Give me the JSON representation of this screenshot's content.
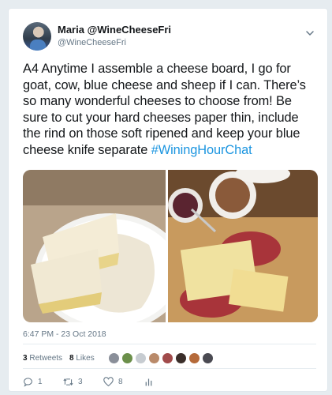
{
  "tweet": {
    "display_name": "Maria @WineCheeseFri",
    "handle": "@WineCheeseFri",
    "text": "A4 Anytime I assemble a cheese board, I go for goat, cow, blue cheese and sheep if I can. There’s so many wonderful cheeses to choose from! Be sure to cut your hard cheeses paper thin, include the rind on those soft ripened and keep your blue cheese knife separate ",
    "hashtag": "#WiningHourChat",
    "timestamp": "6:47 PM - 23 Oct 2018"
  },
  "stats": {
    "retweets_count": "3",
    "retweets_label": "Retweets",
    "likes_count": "8",
    "likes_label": "Likes"
  },
  "actions": {
    "reply_count": "1",
    "retweet_count": "3",
    "like_count": "8"
  },
  "icons": [
    "chevron-down-icon",
    "reply-icon",
    "retweet-icon",
    "heart-icon",
    "analytics-icon"
  ],
  "colors": {
    "link": "#1b95e0",
    "text": "#14171a",
    "muted": "#657786",
    "background": "#e6ecf0"
  }
}
